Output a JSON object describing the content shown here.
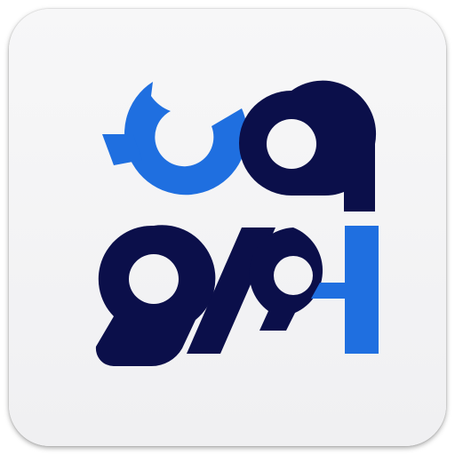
{
  "app_icon": {
    "name": "app-logo",
    "colors": {
      "background": "#f4f4f5",
      "navy": "#0b0f4a",
      "blue": "#1f6fe0"
    }
  }
}
